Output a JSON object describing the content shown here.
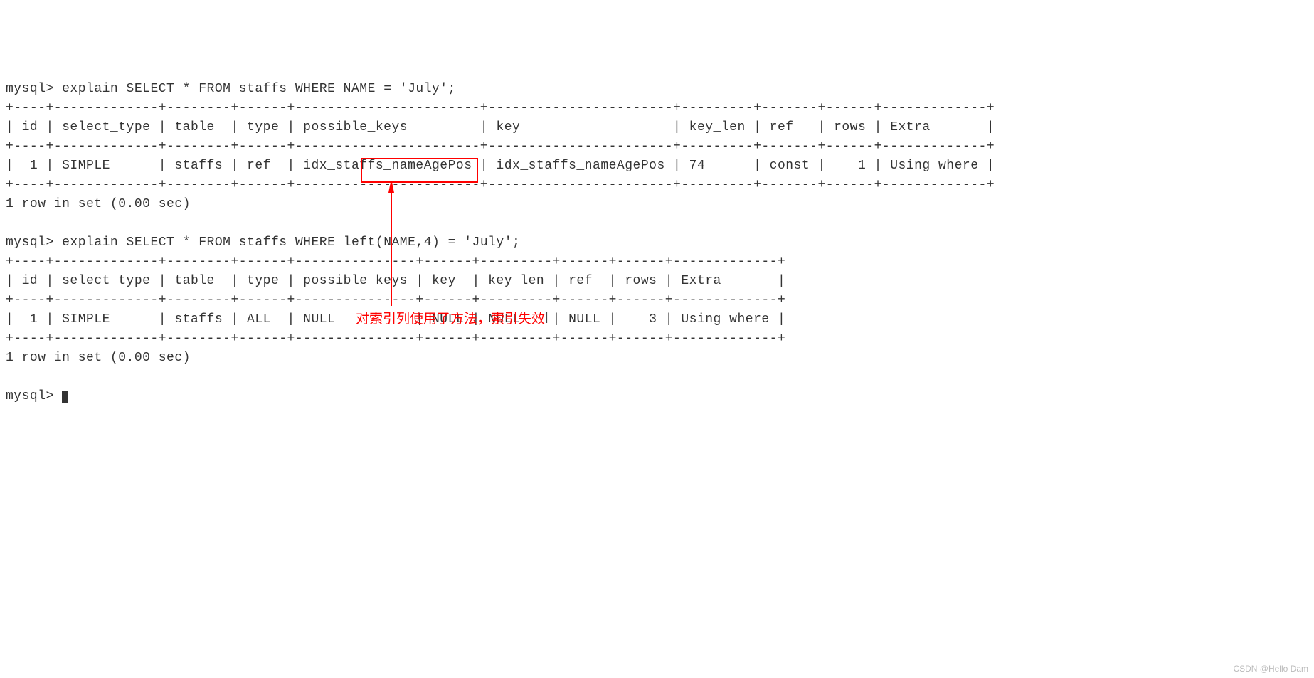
{
  "q1": {
    "prompt": "mysql> ",
    "cmd": "explain SELECT * FROM staffs WHERE NAME = 'July';",
    "border": {
      "top": "+----+-------------+--------+------+-----------------------+-----------------------+---------+-------+------+-------------+",
      "header": "| id | select_type | table  | type | possible_keys         | key                   | key_len | ref   | rows | Extra       |",
      "mid": "+----+-------------+--------+------+-----------------------+-----------------------+---------+-------+------+-------------+",
      "row": "|  1 | SIMPLE      | staffs | ref  | idx_staffs_nameAgePos | idx_staffs_nameAgePos | 74      | const |    1 | Using where |",
      "bot": "+----+-------------+--------+------+-----------------------+-----------------------+---------+-------+------+-------------+"
    },
    "rows_msg": "1 row in set (0.00 sec)"
  },
  "q2": {
    "prompt": "mysql> ",
    "cmd_pre": "explain SELECT * FROM staffs WHERE ",
    "cmd_highlight": "left(NAME,4)",
    "cmd_post": " = 'July';",
    "border": {
      "top": "+----+-------------+--------+------+---------------+------+---------+------+------+-------------+",
      "header": "| id | select_type | table  | type | possible_keys | key  | key_len | ref  | rows | Extra       |",
      "mid": "+----+-------------+--------+------+---------------+------+---------+------+------+-------------+",
      "row": "|  1 | SIMPLE      | staffs | ALL  | NULL          | NULL | NULL    | NULL |    3 | Using where |",
      "bot": "+----+-------------+--------+------+---------------+------+---------+------+------+-------------+"
    },
    "rows_msg": "1 row in set (0.00 sec)"
  },
  "final_prompt": "mysql> ",
  "annotation_text": "对索引列使用了方法，索引失效",
  "watermark": "CSDN @Hello Dam",
  "chart_data": {
    "type": "table",
    "tables": [
      {
        "query": "explain SELECT * FROM staffs WHERE NAME = 'July';",
        "columns": [
          "id",
          "select_type",
          "table",
          "type",
          "possible_keys",
          "key",
          "key_len",
          "ref",
          "rows",
          "Extra"
        ],
        "rows": [
          [
            "1",
            "SIMPLE",
            "staffs",
            "ref",
            "idx_staffs_nameAgePos",
            "idx_staffs_nameAgePos",
            "74",
            "const",
            "1",
            "Using where"
          ]
        ],
        "footer": "1 row in set (0.00 sec)"
      },
      {
        "query": "explain SELECT * FROM staffs WHERE left(NAME,4) = 'July';",
        "columns": [
          "id",
          "select_type",
          "table",
          "type",
          "possible_keys",
          "key",
          "key_len",
          "ref",
          "rows",
          "Extra"
        ],
        "rows": [
          [
            "1",
            "SIMPLE",
            "staffs",
            "ALL",
            "NULL",
            "NULL",
            "NULL",
            "NULL",
            "3",
            "Using where"
          ]
        ],
        "footer": "1 row in set (0.00 sec)"
      }
    ]
  }
}
